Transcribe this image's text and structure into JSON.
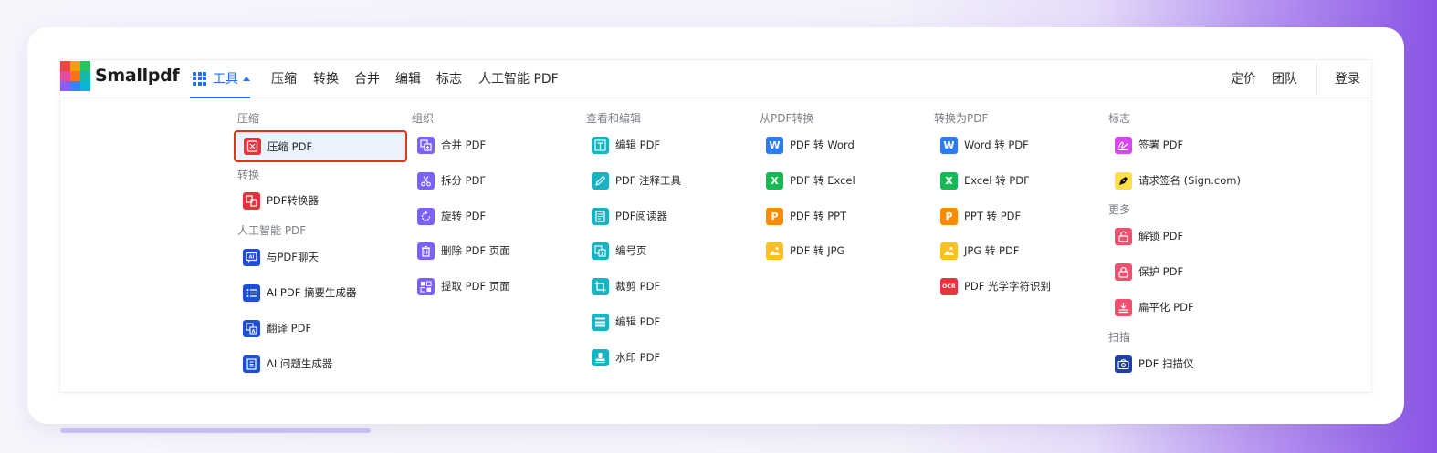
{
  "brand": {
    "name": "Smallpdf"
  },
  "nav": {
    "tools": "工具",
    "items": [
      "压缩",
      "转换",
      "合并",
      "编辑",
      "标志",
      "人工智能 PDF"
    ],
    "right": {
      "pricing": "定价",
      "team": "团队",
      "login": "登录"
    }
  },
  "columns": {
    "compress": {
      "header": "压缩",
      "items": [
        {
          "label": "压缩 PDF",
          "icon": "compress-icon"
        }
      ]
    },
    "convert": {
      "header": "转换",
      "items": [
        {
          "label": "PDF转换器",
          "icon": "converter-icon"
        }
      ]
    },
    "ai": {
      "header": "人工智能 PDF",
      "items": [
        {
          "label": "与PDF聊天",
          "icon": "ai-chat-icon"
        },
        {
          "label": "AI PDF 摘要生成器",
          "icon": "summary-icon"
        },
        {
          "label": "翻译 PDF",
          "icon": "translate-icon"
        },
        {
          "label": "AI 问题生成器",
          "icon": "question-icon"
        }
      ]
    },
    "organize": {
      "header": "组织",
      "items": [
        {
          "label": "合并 PDF",
          "icon": "merge-icon"
        },
        {
          "label": "拆分 PDF",
          "icon": "scissors-icon"
        },
        {
          "label": "旋转 PDF",
          "icon": "rotate-icon"
        },
        {
          "label": "删除 PDF 页面",
          "icon": "trash-icon"
        },
        {
          "label": "提取 PDF 页面",
          "icon": "extract-icon"
        }
      ]
    },
    "view": {
      "header": "查看和编辑",
      "items": [
        {
          "label": "编辑 PDF",
          "icon": "text-edit-icon"
        },
        {
          "label": "PDF 注释工具",
          "icon": "pen-icon"
        },
        {
          "label": "PDF阅读器",
          "icon": "reader-icon"
        },
        {
          "label": "编号页",
          "icon": "number-icon"
        },
        {
          "label": "裁剪 PDF",
          "icon": "crop-icon"
        },
        {
          "label": "编辑 PDF",
          "icon": "edit-layout-icon"
        },
        {
          "label": "水印 PDF",
          "icon": "watermark-icon"
        }
      ]
    },
    "from_pdf": {
      "header": "从PDF转换",
      "items": [
        {
          "label": "PDF 转 Word",
          "icon": "word-icon",
          "glyph": "W"
        },
        {
          "label": "PDF 转 Excel",
          "icon": "excel-icon",
          "glyph": "X"
        },
        {
          "label": "PDF 转 PPT",
          "icon": "ppt-icon",
          "glyph": "P"
        },
        {
          "label": "PDF 转 JPG",
          "icon": "image-icon"
        }
      ]
    },
    "to_pdf": {
      "header": "转换为PDF",
      "items": [
        {
          "label": "Word 转 PDF",
          "icon": "word-icon",
          "glyph": "W"
        },
        {
          "label": "Excel 转 PDF",
          "icon": "excel-icon",
          "glyph": "X"
        },
        {
          "label": "PPT 转 PDF",
          "icon": "ppt-icon",
          "glyph": "P"
        },
        {
          "label": "JPG 转 PDF",
          "icon": "image-icon"
        },
        {
          "label": "PDF 光学字符识别",
          "icon": "ocr-icon",
          "glyph": "OCR"
        }
      ]
    },
    "sign": {
      "header": "标志",
      "items": [
        {
          "label": "签署 PDF",
          "icon": "signature-icon"
        },
        {
          "label": "请求签名 (Sign.com)",
          "icon": "pen-nib-icon"
        }
      ]
    },
    "more": {
      "header": "更多",
      "items": [
        {
          "label": "解锁 PDF",
          "icon": "unlock-icon"
        },
        {
          "label": "保护 PDF",
          "icon": "lock-icon"
        },
        {
          "label": "扁平化 PDF",
          "icon": "flatten-icon"
        }
      ]
    },
    "scan": {
      "header": "扫描",
      "items": [
        {
          "label": "PDF 扫描仪",
          "icon": "camera-icon"
        }
      ]
    }
  }
}
